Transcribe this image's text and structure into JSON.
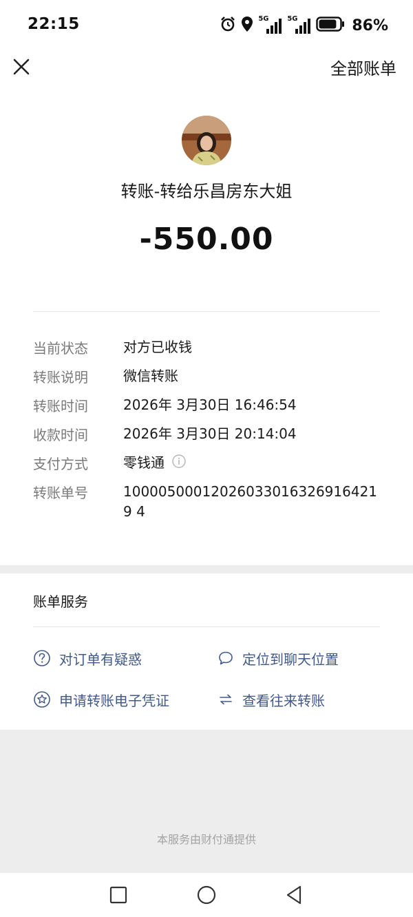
{
  "status_bar": {
    "time": "22:15",
    "net1": "5G",
    "net2": "5G",
    "battery": "86%",
    "battery_level": 0.86
  },
  "header": {
    "close_icon": "close-icon",
    "all_bills": "全部账单"
  },
  "transfer": {
    "title": "转账-转给乐昌房东大姐",
    "amount": "-550.00"
  },
  "details": [
    {
      "label": "当前状态",
      "value": "对方已收钱"
    },
    {
      "label": "转账说明",
      "value": "微信转账"
    },
    {
      "label": "转账时间",
      "value": "2026年 3月30日 16:46:54"
    },
    {
      "label": "收款时间",
      "value": "2026年 3月30日 20:14:04"
    },
    {
      "label": "支付方式",
      "value": "零钱通"
    },
    {
      "label": "转账单号",
      "value": "100005000120260330163269164219 4"
    }
  ],
  "services": {
    "title": "账单服务",
    "items": [
      {
        "label": "对订单有疑惑",
        "icon": "question-icon"
      },
      {
        "label": "定位到聊天位置",
        "icon": "chat-bubble-icon"
      },
      {
        "label": "申请转账电子凭证",
        "icon": "star-badge-icon"
      },
      {
        "label": "查看往来转账",
        "icon": "swap-arrows-icon"
      }
    ]
  },
  "footer": {
    "text": "本服务由财付通提供"
  },
  "colors": {
    "link": "#41598a",
    "label": "#7a7a7a",
    "band": "#ededed"
  }
}
